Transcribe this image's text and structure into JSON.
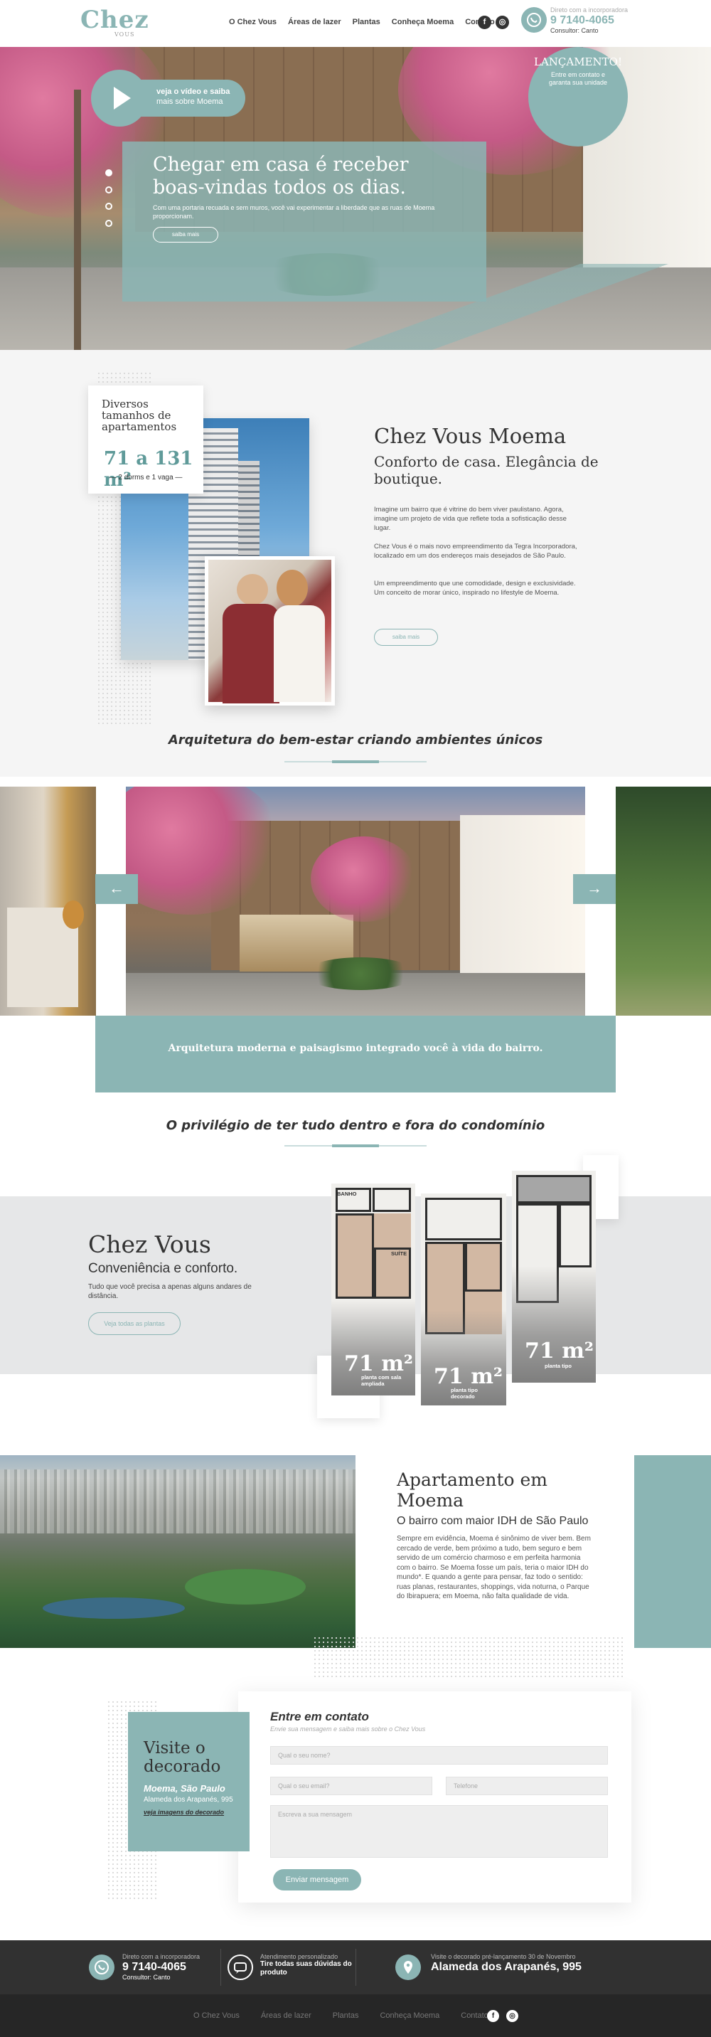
{
  "header": {
    "logo": "Chez",
    "logo_small": "VOUS",
    "nav": [
      "O Chez Vous",
      "Áreas de lazer",
      "Plantas",
      "Conheça Moema",
      "Contato"
    ],
    "social": [
      "f",
      "◎"
    ],
    "contact_label": "Direto com a incorporadora",
    "phone": "9 7140-4065",
    "consultant": "Consultor: Canto"
  },
  "hero": {
    "title": "Chegar em casa é receber boas-vindas todos os dias.",
    "subtitle": "Com uma portaria recuada e sem muros, você vai experimentar a liberdade que as ruas de Moema proporcionam.",
    "button": "saiba mais",
    "launch_title": "LANÇAMENTO!",
    "launch_text": "Entre em contato e garanta sua unidade"
  },
  "about": {
    "card_heading": "Diversos tamanhos de apartamentos",
    "card_size": "71 a 131 m²",
    "card_detail": "2 dorms e 1 vaga",
    "title": "Chez Vous Moema",
    "subtitle": "Conforto de casa. Elegância de boutique.",
    "paragraphs": [
      "Imagine um bairro que é vitrine do bem viver paulistano. Agora, imagine um projeto de vida que reflete toda a sofisticação desse lugar.",
      "Chez Vous é o mais novo empreendimento da Tegra Incorporadora, localizado em um dos endereços mais desejados de São Paulo.",
      "Um empreendimento que une comodidade, design e exclusividade. Um conceito de morar único, inspirado no lifestyle de Moema."
    ],
    "button": "saiba mais"
  },
  "architecture": {
    "title": "Arquitetura do bem-estar criando ambientes únicos",
    "caption": "Arquitetura moderna e paisagismo integrado você à vida do bairro.",
    "prev": "←",
    "next": "→"
  },
  "privilege": {
    "title": "O privilégio de ter tudo dentro e fora do condomínio"
  },
  "plants": {
    "title": "Chez Vous",
    "subtitle": "Conveniência e conforto.",
    "text": "Tudo que você precisa a apenas alguns andares de distância.",
    "button": "Veja todas as plantas",
    "cards": [
      {
        "size": "71 m²",
        "label": "planta com sala ampliada",
        "rooms": [
          "BANHO",
          "SUÍTE"
        ]
      },
      {
        "size": "71 m²",
        "label": "planta tipo decorado",
        "rooms": []
      },
      {
        "size": "71 m²",
        "label": "planta tipo",
        "rooms": []
      }
    ]
  },
  "neighborhood": {
    "video_line1": "veja o vídeo e saiba",
    "video_line2": "mais sobre Moema",
    "title": "Apartamento em Moema",
    "subtitle": "O bairro com maior IDH de São Paulo",
    "text": "Sempre em evidência, Moema é sinônimo de viver bem. Bem cercado de verde, bem próximo a tudo, bem seguro e bem servido de um comércio charmoso e em perfeita harmonia com o bairro. Se Moema fosse um país, teria o maior IDH do mundo*. E quando a gente para pensar, faz todo o sentido: ruas planas, restaurantes, shoppings, vida noturna, o Parque do Ibirapuera; em Moema, não falta qualidade de vida."
  },
  "contact": {
    "visit_title": "Visite o decorado",
    "visit_location": "Moema, São Paulo",
    "visit_address": "Alameda dos Arapanés, 995",
    "visit_link": "veja imagens do decorado",
    "form_title": "Entre em contato",
    "form_subtitle": "Envie sua mensagem e saiba mais sobre o Chez Vous",
    "name_placeholder": "Qual o seu nome?",
    "email_placeholder": "Qual o seu email?",
    "phone_placeholder": "Telefone",
    "message_placeholder": "Escreva a sua mensagem",
    "send": "Enviar mensagem"
  },
  "footer": {
    "col1_label": "Direto com a incorporadora",
    "col1_phone": "9 7140-4065",
    "col1_consultant": "Consultor: Canto",
    "col2_label": "Atendimento personalizado",
    "col2_text": "Tire todas suas dúvidas do produto",
    "col3_label": "Visite o decorado pré-lançamento 30 de Novembro",
    "col3_address": "Alameda dos Arapanés, 995",
    "nav": [
      "O Chez Vous",
      "Áreas de lazer",
      "Plantas",
      "Conheça Moema",
      "Contato"
    ],
    "social": [
      "f",
      "◎"
    ]
  },
  "colors": {
    "accent": "#8bb5b4",
    "dark": "#313131",
    "light_band": "#e6e7e8"
  }
}
